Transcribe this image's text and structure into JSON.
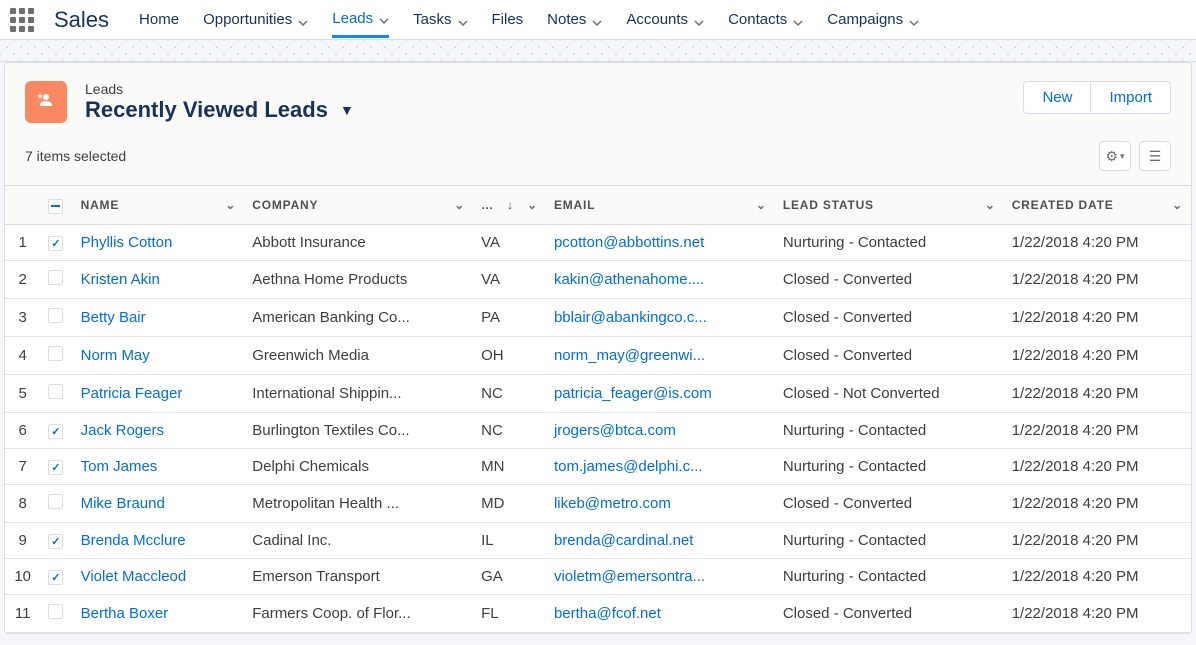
{
  "nav": {
    "app": "Sales",
    "items": [
      {
        "label": "Home",
        "chev": false
      },
      {
        "label": "Opportunities",
        "chev": true
      },
      {
        "label": "Leads",
        "chev": true,
        "active": true
      },
      {
        "label": "Tasks",
        "chev": true
      },
      {
        "label": "Files",
        "chev": false
      },
      {
        "label": "Notes",
        "chev": true
      },
      {
        "label": "Accounts",
        "chev": true
      },
      {
        "label": "Contacts",
        "chev": true
      },
      {
        "label": "Campaigns",
        "chev": true
      }
    ]
  },
  "header": {
    "object_label": "Leads",
    "view_name": "Recently Viewed Leads",
    "actions": {
      "new": "New",
      "import": "Import"
    },
    "selection_text": "7 items selected"
  },
  "table": {
    "columns": [
      "NAME",
      "COMPANY",
      "…",
      "EMAIL",
      "LEAD STATUS",
      "CREATED DATE"
    ],
    "state_sort_label": "…",
    "rows": [
      {
        "n": 1,
        "checked": true,
        "name": "Phyllis Cotton",
        "company": "Abbott Insurance",
        "state": "VA",
        "email": "pcotton@abbottins.net",
        "status": "Nurturing - Contacted",
        "date": "1/22/2018 4:20 PM"
      },
      {
        "n": 2,
        "checked": false,
        "name": "Kristen Akin",
        "company": "Aethna Home Products",
        "state": "VA",
        "email": "kakin@athenahome....",
        "status": "Closed - Converted",
        "date": "1/22/2018 4:20 PM"
      },
      {
        "n": 3,
        "checked": false,
        "name": "Betty Bair",
        "company": "American Banking Co...",
        "state": "PA",
        "email": "bblair@abankingco.c...",
        "status": "Closed - Converted",
        "date": "1/22/2018 4:20 PM"
      },
      {
        "n": 4,
        "checked": false,
        "name": "Norm May",
        "company": "Greenwich Media",
        "state": "OH",
        "email": "norm_may@greenwi...",
        "status": "Closed - Converted",
        "date": "1/22/2018 4:20 PM"
      },
      {
        "n": 5,
        "checked": false,
        "name": "Patricia Feager",
        "company": "International Shippin...",
        "state": "NC",
        "email": "patricia_feager@is.com",
        "status": "Closed - Not Converted",
        "date": "1/22/2018 4:20 PM"
      },
      {
        "n": 6,
        "checked": true,
        "name": "Jack Rogers",
        "company": "Burlington Textiles Co...",
        "state": "NC",
        "email": "jrogers@btca.com",
        "status": "Nurturing - Contacted",
        "date": "1/22/2018 4:20 PM"
      },
      {
        "n": 7,
        "checked": true,
        "name": "Tom James",
        "company": "Delphi Chemicals",
        "state": "MN",
        "email": "tom.james@delphi.c...",
        "status": "Nurturing - Contacted",
        "date": "1/22/2018 4:20 PM"
      },
      {
        "n": 8,
        "checked": false,
        "name": "Mike Braund",
        "company": "Metropolitan Health ...",
        "state": "MD",
        "email": "likeb@metro.com",
        "status": "Closed - Converted",
        "date": "1/22/2018 4:20 PM"
      },
      {
        "n": 9,
        "checked": true,
        "name": "Brenda Mcclure",
        "company": "Cadinal Inc.",
        "state": "IL",
        "email": "brenda@cardinal.net",
        "status": "Nurturing - Contacted",
        "date": "1/22/2018 4:20 PM"
      },
      {
        "n": 10,
        "checked": true,
        "name": "Violet Maccleod",
        "company": "Emerson Transport",
        "state": "GA",
        "email": "violetm@emersontra...",
        "status": "Nurturing - Contacted",
        "date": "1/22/2018 4:20 PM"
      },
      {
        "n": 11,
        "checked": false,
        "name": "Bertha Boxer",
        "company": "Farmers Coop. of Flor...",
        "state": "FL",
        "email": "bertha@fcof.net",
        "status": "Closed - Converted",
        "date": "1/22/2018 4:20 PM"
      }
    ]
  }
}
